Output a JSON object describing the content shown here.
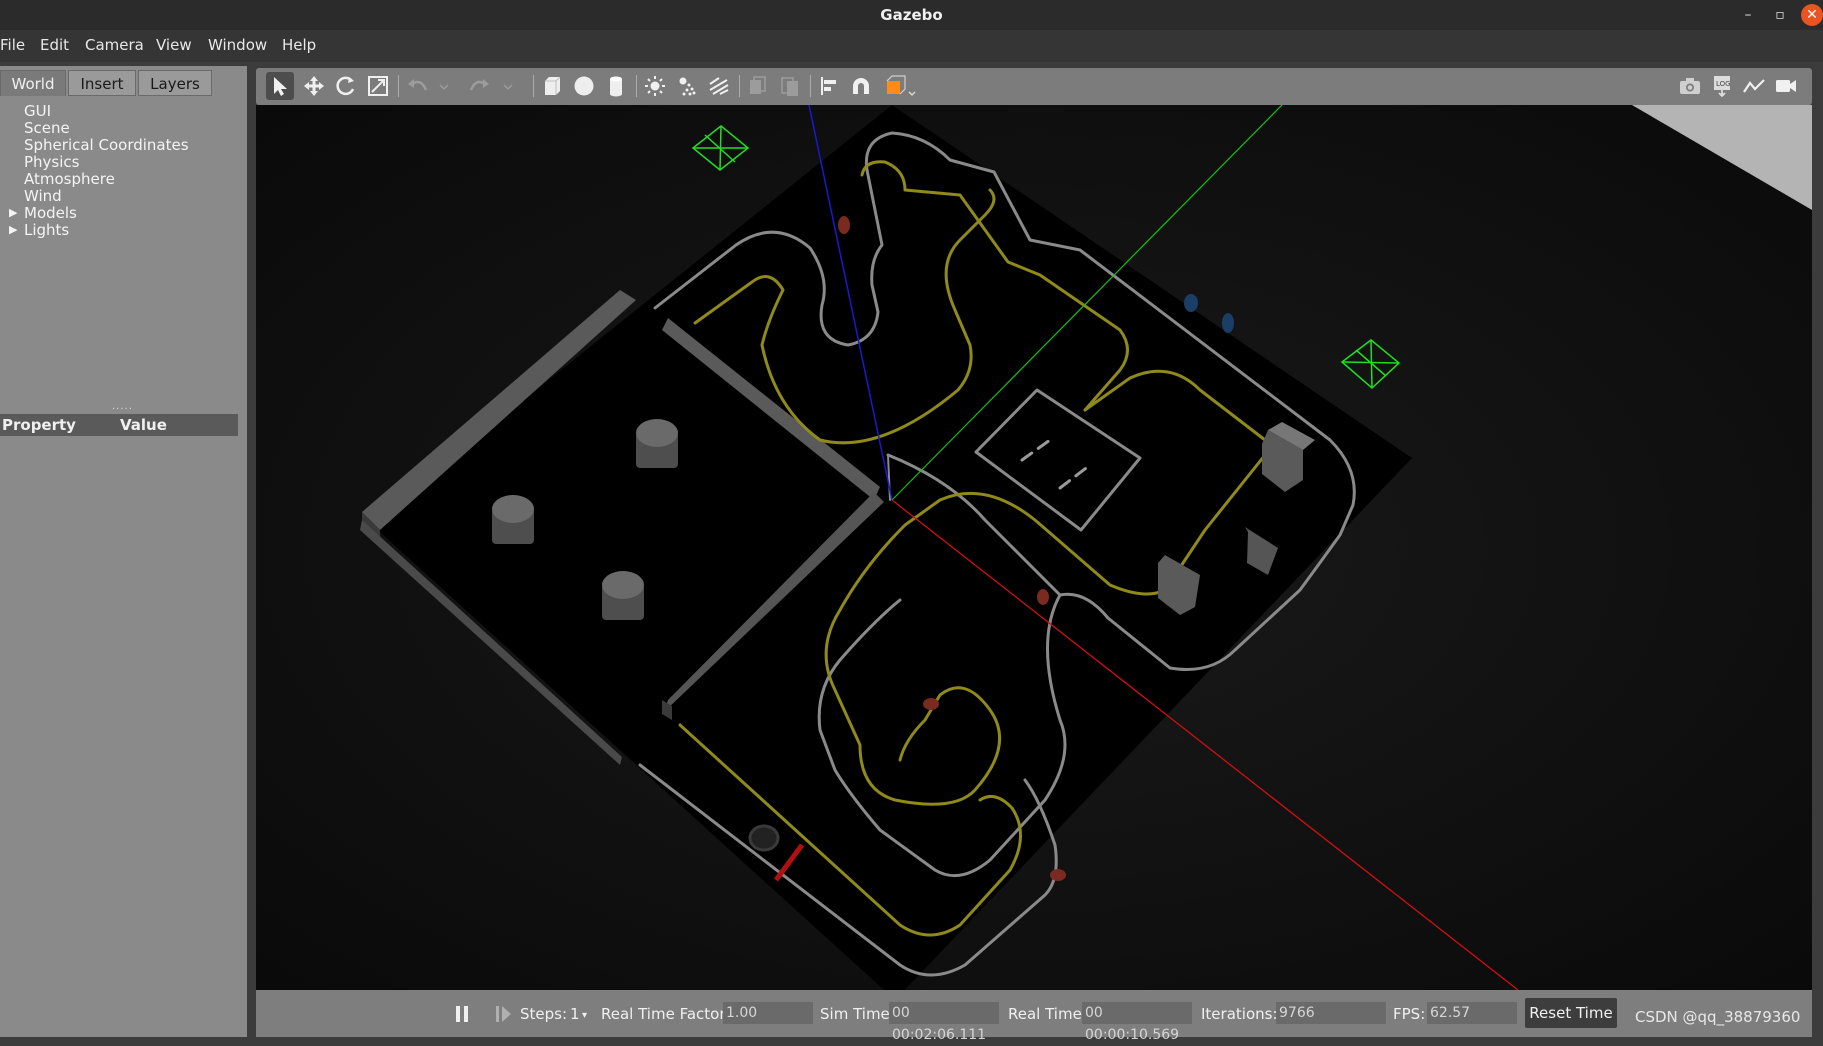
{
  "window": {
    "title": "Gazebo",
    "minimize": "–",
    "maximize": "▫",
    "close": "✕"
  },
  "menu": [
    "File",
    "Edit",
    "Camera",
    "View",
    "Window",
    "Help"
  ],
  "left_tabs": [
    "World",
    "Insert",
    "Layers"
  ],
  "world_tree": [
    "GUI",
    "Scene",
    "Spherical Coordinates",
    "Physics",
    "Atmosphere",
    "Wind",
    "Models",
    "Lights"
  ],
  "property_table": {
    "col_property": "Property",
    "col_value": "Value"
  },
  "toolbar": {
    "icons": [
      "select-icon",
      "translate-icon",
      "rotate-icon",
      "scale-icon",
      "undo-icon",
      "redo-icon",
      "box-icon",
      "sphere-icon",
      "cylinder-icon",
      "point-light-icon",
      "spot-light-icon",
      "directional-light-icon",
      "copy-icon",
      "paste-icon",
      "align-icon",
      "snap-icon",
      "view-angle-icon",
      "screenshot-icon",
      "log-icon",
      "plot-icon",
      "record-icon"
    ]
  },
  "status": {
    "steps_label": "Steps:",
    "steps_value": "1",
    "rtf_label": "Real Time Factor:",
    "rtf_value": "1.00",
    "sim_time_label": "Sim Time:",
    "sim_time_value": "00 00:02:06.111",
    "real_time_label": "Real Time:",
    "real_time_value": "00 00:00:10.569",
    "iterations_label": "Iterations:",
    "iterations_value": "9766",
    "fps_label": "FPS:",
    "fps_value": "62.57",
    "reset_label": "Reset Time"
  },
  "watermark": "CSDN @qq_38879360",
  "colors": {
    "track_yellow": "#8f8a1a",
    "track_white": "#9a9a9a",
    "axis_x": "#d01010",
    "axis_y": "#14c014",
    "axis_z": "#1a1acf",
    "camera_frame": "#22dd22"
  }
}
